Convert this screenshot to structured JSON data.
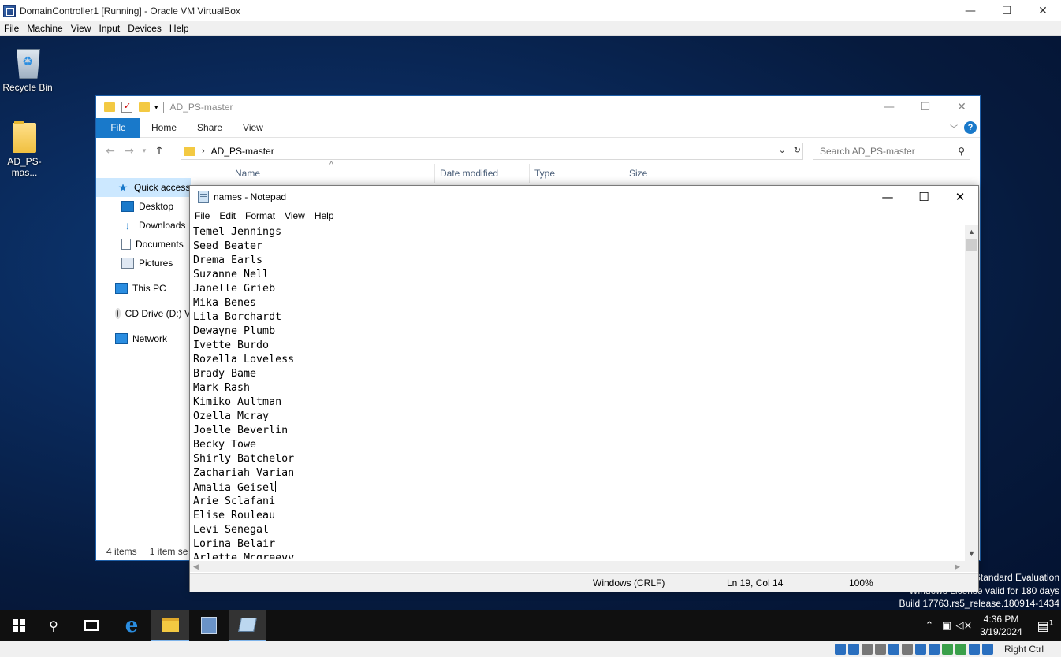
{
  "vbox": {
    "title": "DomainController1 [Running] - Oracle VM VirtualBox",
    "menu": [
      "File",
      "Machine",
      "View",
      "Input",
      "Devices",
      "Help"
    ],
    "host_key": "Right Ctrl"
  },
  "desktop": {
    "icons": [
      {
        "label": "Recycle Bin",
        "icon": "recycle-bin-icon"
      },
      {
        "label": "AD_PS-mas...",
        "icon": "folder-icon"
      }
    ],
    "watermark": {
      "line1": "Standard Evaluation",
      "line2": "Windows License valid for 180 days",
      "line3": "Build 17763.rs5_release.180914-1434"
    }
  },
  "explorer": {
    "title": "AD_PS-master",
    "ribbon_tabs": [
      "File",
      "Home",
      "Share",
      "View"
    ],
    "address": "AD_PS-master",
    "search_placeholder": "Search AD_PS-master",
    "nav_items": [
      {
        "label": "Quick access",
        "icon": "star-icon"
      },
      {
        "label": "Desktop",
        "icon": "desktop-icon"
      },
      {
        "label": "Downloads",
        "icon": "download-icon"
      },
      {
        "label": "Documents",
        "icon": "document-icon"
      },
      {
        "label": "Pictures",
        "icon": "pictures-icon"
      },
      {
        "label": "This PC",
        "icon": "computer-icon"
      },
      {
        "label": "CD Drive (D:) V",
        "icon": "cd-drive-icon"
      },
      {
        "label": "Network",
        "icon": "network-icon"
      }
    ],
    "columns": [
      "Name",
      "Date modified",
      "Type",
      "Size"
    ],
    "status_items": "4 items",
    "status_selected": "1 item se"
  },
  "notepad": {
    "title": "names - Notepad",
    "menu": [
      "File",
      "Edit",
      "Format",
      "View",
      "Help"
    ],
    "lines": [
      "Temel Jennings",
      "Seed Beater",
      "Drema Earls",
      "Suzanne Nell",
      "Janelle Grieb",
      "Mika Benes",
      "Lila Borchardt",
      "Dewayne Plumb",
      "Ivette Burdo",
      "Rozella Loveless",
      "Brady Bame",
      "Mark Rash",
      "Kimiko Aultman",
      "Ozella Mcray",
      "Joelle Beverlin",
      "Becky Towe",
      "Shirly Batchelor",
      "Zachariah Varian",
      "Amalia Geisel",
      "Arie Sclafani",
      "Elise Rouleau",
      "Levi Senegal",
      "Lorina Belair",
      "Arlette Mcgreevy"
    ],
    "caret_line": 19,
    "status": {
      "line_ending": "Windows (CRLF)",
      "position": "Ln 19, Col 14",
      "zoom": "100%"
    }
  },
  "taskbar": {
    "clock_time": "4:36 PM",
    "clock_date": "3/19/2024",
    "notification_count": "1"
  }
}
